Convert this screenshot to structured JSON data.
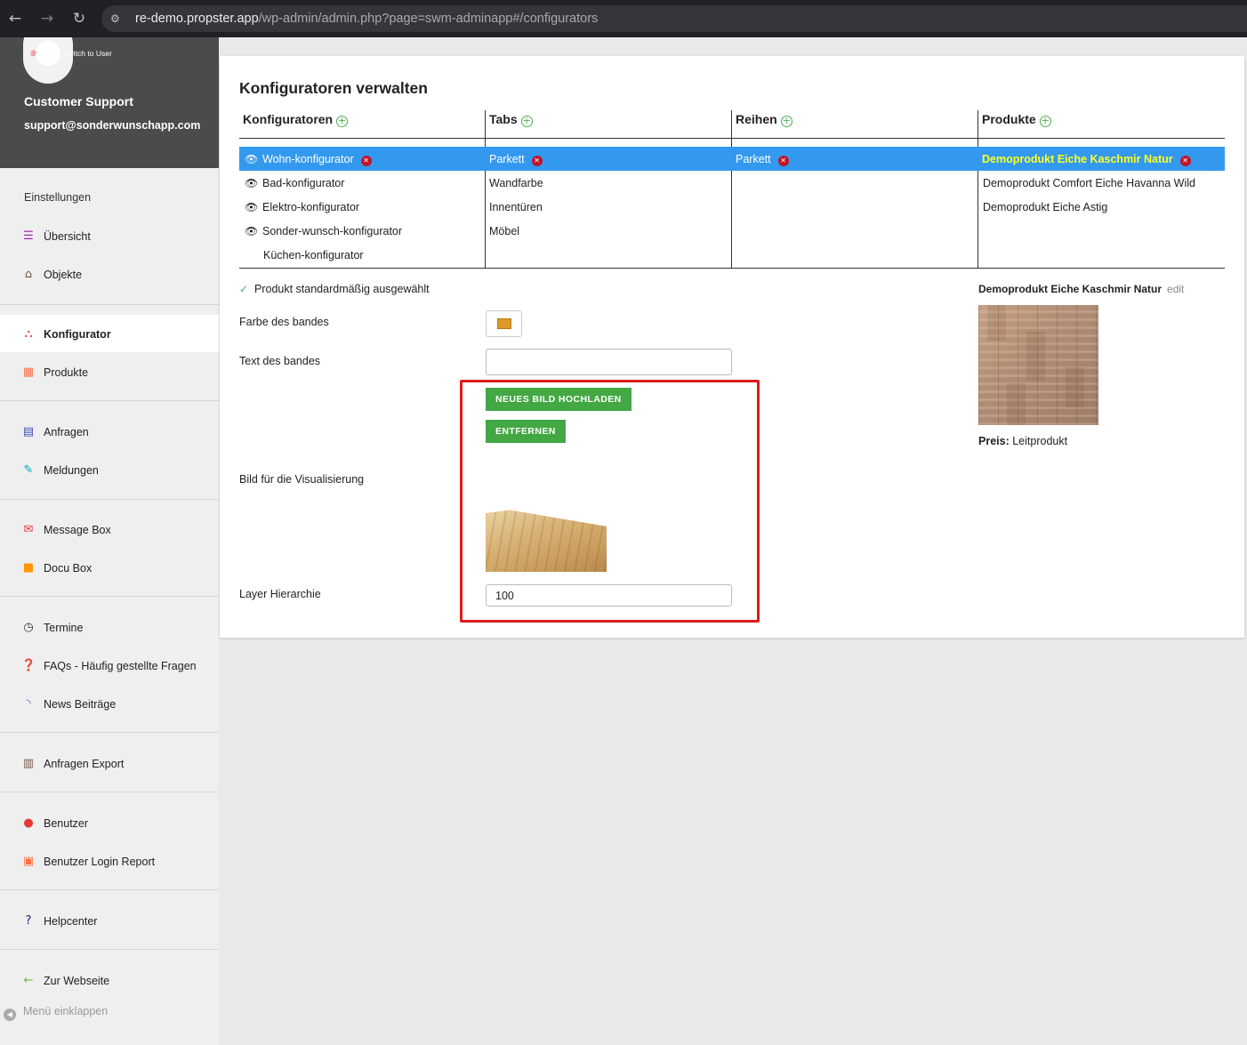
{
  "browser": {
    "url_host": "re-demo.propster.app",
    "url_path": "/wp-admin/admin.php?page=swm-adminapp#/configurators"
  },
  "user": {
    "switch_label": "Switch to User",
    "name": "Customer Support",
    "email": "support@sonderwunschapp.com"
  },
  "sidebar": {
    "settings_label": "Einstellungen",
    "items": [
      {
        "label": "Übersicht",
        "icon": "list-icon",
        "color": "#9c27b0"
      },
      {
        "label": "Objekte",
        "icon": "home-icon",
        "color": "#795548"
      },
      {
        "label": "Konfigurator",
        "icon": "sitemap-icon",
        "color": "#e53935"
      },
      {
        "label": "Produkte",
        "icon": "table-icon",
        "color": "#ff7043"
      },
      {
        "label": "Anfragen",
        "icon": "list-alt-icon",
        "color": "#3f51b5"
      },
      {
        "label": "Meldungen",
        "icon": "edit-note-icon",
        "color": "#00acc1"
      },
      {
        "label": "Message Box",
        "icon": "message-icon",
        "color": "#e53935"
      },
      {
        "label": "Docu Box",
        "icon": "folder-icon",
        "color": "#ff9800"
      },
      {
        "label": "Termine",
        "icon": "clock-icon",
        "color": "#333333"
      },
      {
        "label": "FAQs - Häufig gestellte Fragen",
        "icon": "question-icon",
        "color": "#333333"
      },
      {
        "label": "News Beiträge",
        "icon": "rss-icon",
        "color": "#7e57c2"
      },
      {
        "label": "Anfragen Export",
        "icon": "spreadsheet-icon",
        "color": "#795548"
      },
      {
        "label": "Benutzer",
        "icon": "user-icon",
        "color": "#e53935"
      },
      {
        "label": "Benutzer Login Report",
        "icon": "id-card-icon",
        "color": "#ff7043"
      },
      {
        "label": "Helpcenter",
        "icon": "help-icon",
        "color": "#1a237e"
      },
      {
        "label": "Zur Webseite",
        "icon": "arrow-left-icon",
        "color": "#7cb342"
      }
    ],
    "collapse_label": "Menü einklappen"
  },
  "main": {
    "title": "Konfiguratoren verwalten",
    "columns": {
      "konfiguratoren": "Konfiguratoren",
      "tabs": "Tabs",
      "reihen": "Reihen",
      "produkte": "Produkte"
    },
    "konfiguratoren": [
      "Wohn-konfigurator",
      "Bad-konfigurator",
      "Elektro-konfigurator",
      "Sonder-wunsch-konfigurator",
      "Küchen-konfigurator"
    ],
    "tabs": [
      "Parkett",
      "Wandfarbe",
      "Innentüren",
      "Möbel"
    ],
    "reihen": [
      "Parkett"
    ],
    "produkte": [
      "Demoprodukt Eiche Kaschmir Natur",
      "Demoprodukt Comfort Eiche Havanna Wild",
      "Demoprodukt Eiche Astig"
    ],
    "selection_color": "#3399ee",
    "selected_product_color": "#ffff22"
  },
  "form": {
    "default_selected_label": "Produkt standardmäßig ausgewählt",
    "band_color_label": "Farbe des bandes",
    "band_color": "#dd9a2a",
    "band_text_label": "Text des bandes",
    "band_text_value": "",
    "image_label": "Bild für die Visualisierung",
    "upload_button": "NEUES BILD HOCHLADEN",
    "remove_button": "ENTFERNEN",
    "layer_label": "Layer Hierarchie",
    "layer_value": "100",
    "highlight_color": "#dd1c1c"
  },
  "product_detail": {
    "name": "Demoprodukt Eiche Kaschmir Natur",
    "edit_label": "edit",
    "price_label": "Preis:",
    "price_value": "Leitprodukt"
  }
}
